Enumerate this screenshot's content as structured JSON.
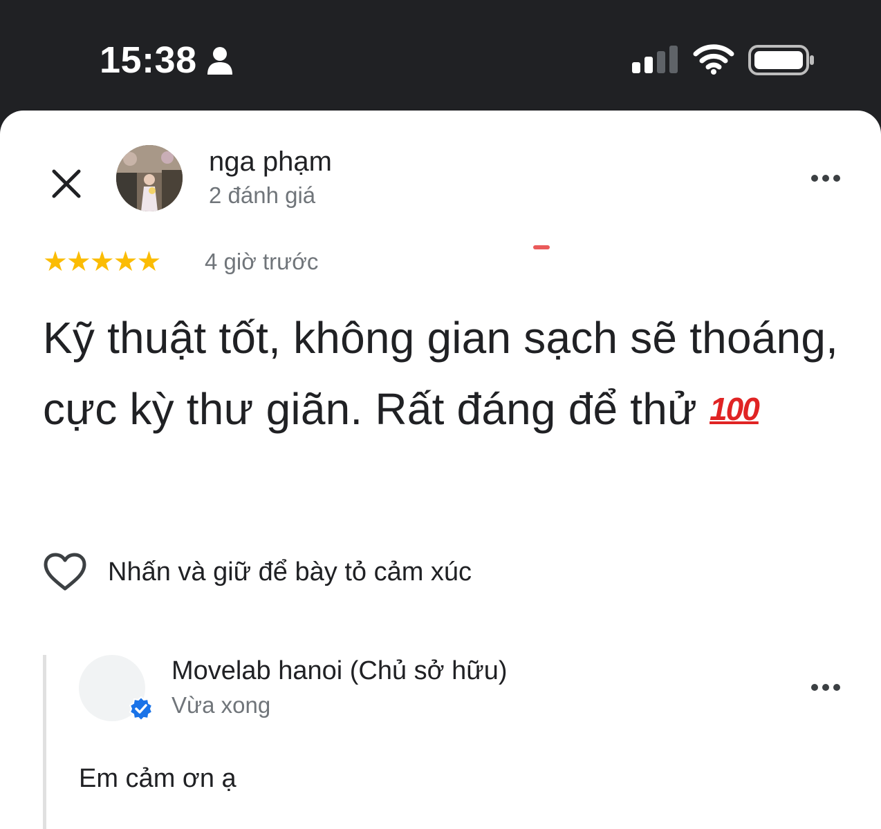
{
  "status_bar": {
    "time": "15:38",
    "icons": [
      "person-icon",
      "signal-icon",
      "wifi-icon",
      "battery-icon"
    ]
  },
  "review": {
    "reviewer_name": "nga phạm",
    "review_count": "2 đánh giá",
    "rating": 5,
    "stars": "★★★★★",
    "time_ago": "4 giờ trước",
    "text": "Kỹ thuật tốt, không gian sạch sẽ thoáng, cực kỳ thư giãn. Rất đáng để thử",
    "emoji": "100",
    "react_label": "Nhấn và giữ để bày tỏ cảm xúc"
  },
  "owner_reply": {
    "name": "Movelab hanoi (Chủ sở hữu)",
    "time": "Vừa xong",
    "text": "Em cảm ơn ạ"
  },
  "colors": {
    "star": "#fbbc04",
    "secondary_text": "#70757a",
    "primary_text": "#202124",
    "verified": "#1a73e8",
    "status_bar": "#202124"
  }
}
